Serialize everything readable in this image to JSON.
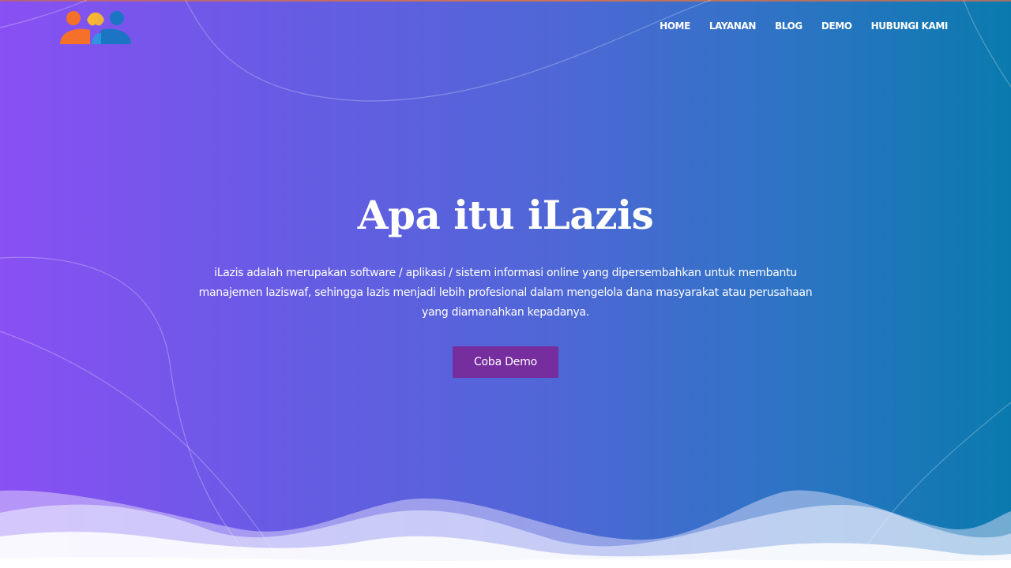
{
  "brand": {
    "logo_icon": "people-logo-icon",
    "colors": {
      "orange": "#f5712a",
      "yellow": "#f6b532",
      "blue": "#1c74c4"
    }
  },
  "nav": {
    "items": [
      {
        "label": "HOME"
      },
      {
        "label": "LAYANAN"
      },
      {
        "label": "BLOG"
      },
      {
        "label": "DEMO"
      },
      {
        "label": "HUBUNGI KAMI"
      }
    ]
  },
  "hero": {
    "title": "Apa itu iLazis",
    "description": "iLazis adalah merupakan software / aplikasi / sistem informasi online yang dipersembahkan untuk membantu manajemen laziswaf, sehingga lazis menjadi lebih profesional dalam mengelola dana masyarakat atau perusahaan yang diamanahkan kepadanya.",
    "cta_label": "Coba Demo"
  },
  "theme": {
    "gradient_start": "#8950f3",
    "gradient_end": "#0a7aae",
    "button_color": "#762d9e"
  }
}
